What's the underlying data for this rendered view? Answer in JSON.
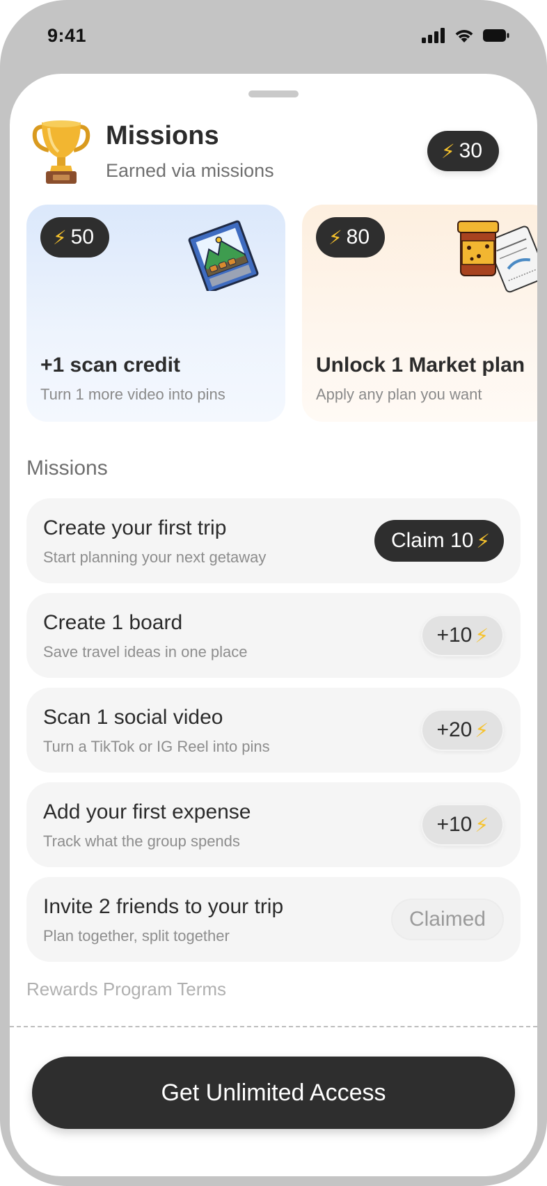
{
  "status_bar": {
    "time": "9:41"
  },
  "header": {
    "title": "Missions",
    "subtitle": "Earned via missions",
    "balance": "30"
  },
  "rewards": [
    {
      "points": "50",
      "title": "+1 scan credit",
      "subtitle": "Turn 1 more video into pins"
    },
    {
      "points": "80",
      "title": "Unlock 1 Market plan",
      "subtitle": "Apply any plan you want"
    }
  ],
  "missions_section": {
    "label": "Missions",
    "items": [
      {
        "title": "Create your first trip",
        "subtitle": "Start planning your next getaway",
        "action": "Claim 10",
        "state": "claimable"
      },
      {
        "title": "Create 1 board",
        "subtitle": "Save travel ideas in one place",
        "action": "+10",
        "state": "pending"
      },
      {
        "title": "Scan 1 social video",
        "subtitle": "Turn a TikTok or IG Reel into pins",
        "action": "+20",
        "state": "pending"
      },
      {
        "title": "Add your first expense",
        "subtitle": "Track what the group spends",
        "action": "+10",
        "state": "pending"
      },
      {
        "title": "Invite 2 friends to your trip",
        "subtitle": "Plan together, split together",
        "action": "Claimed",
        "state": "claimed"
      }
    ]
  },
  "footer": {
    "terms_link": "Rewards Program Terms",
    "cta_label": "Get Unlimited Access"
  },
  "colors": {
    "dark_pill": "#2e2e2e",
    "bolt": "#f6c22c",
    "card_blue": "#dbe8fb",
    "card_orange": "#fdefdf",
    "mission_bg": "#f5f5f5"
  },
  "icons": {
    "bolt": "lightning-bolt-icon",
    "trophy": "trophy-icon",
    "signal": "cellular-signal-icon",
    "wifi": "wifi-icon",
    "battery": "battery-icon"
  }
}
